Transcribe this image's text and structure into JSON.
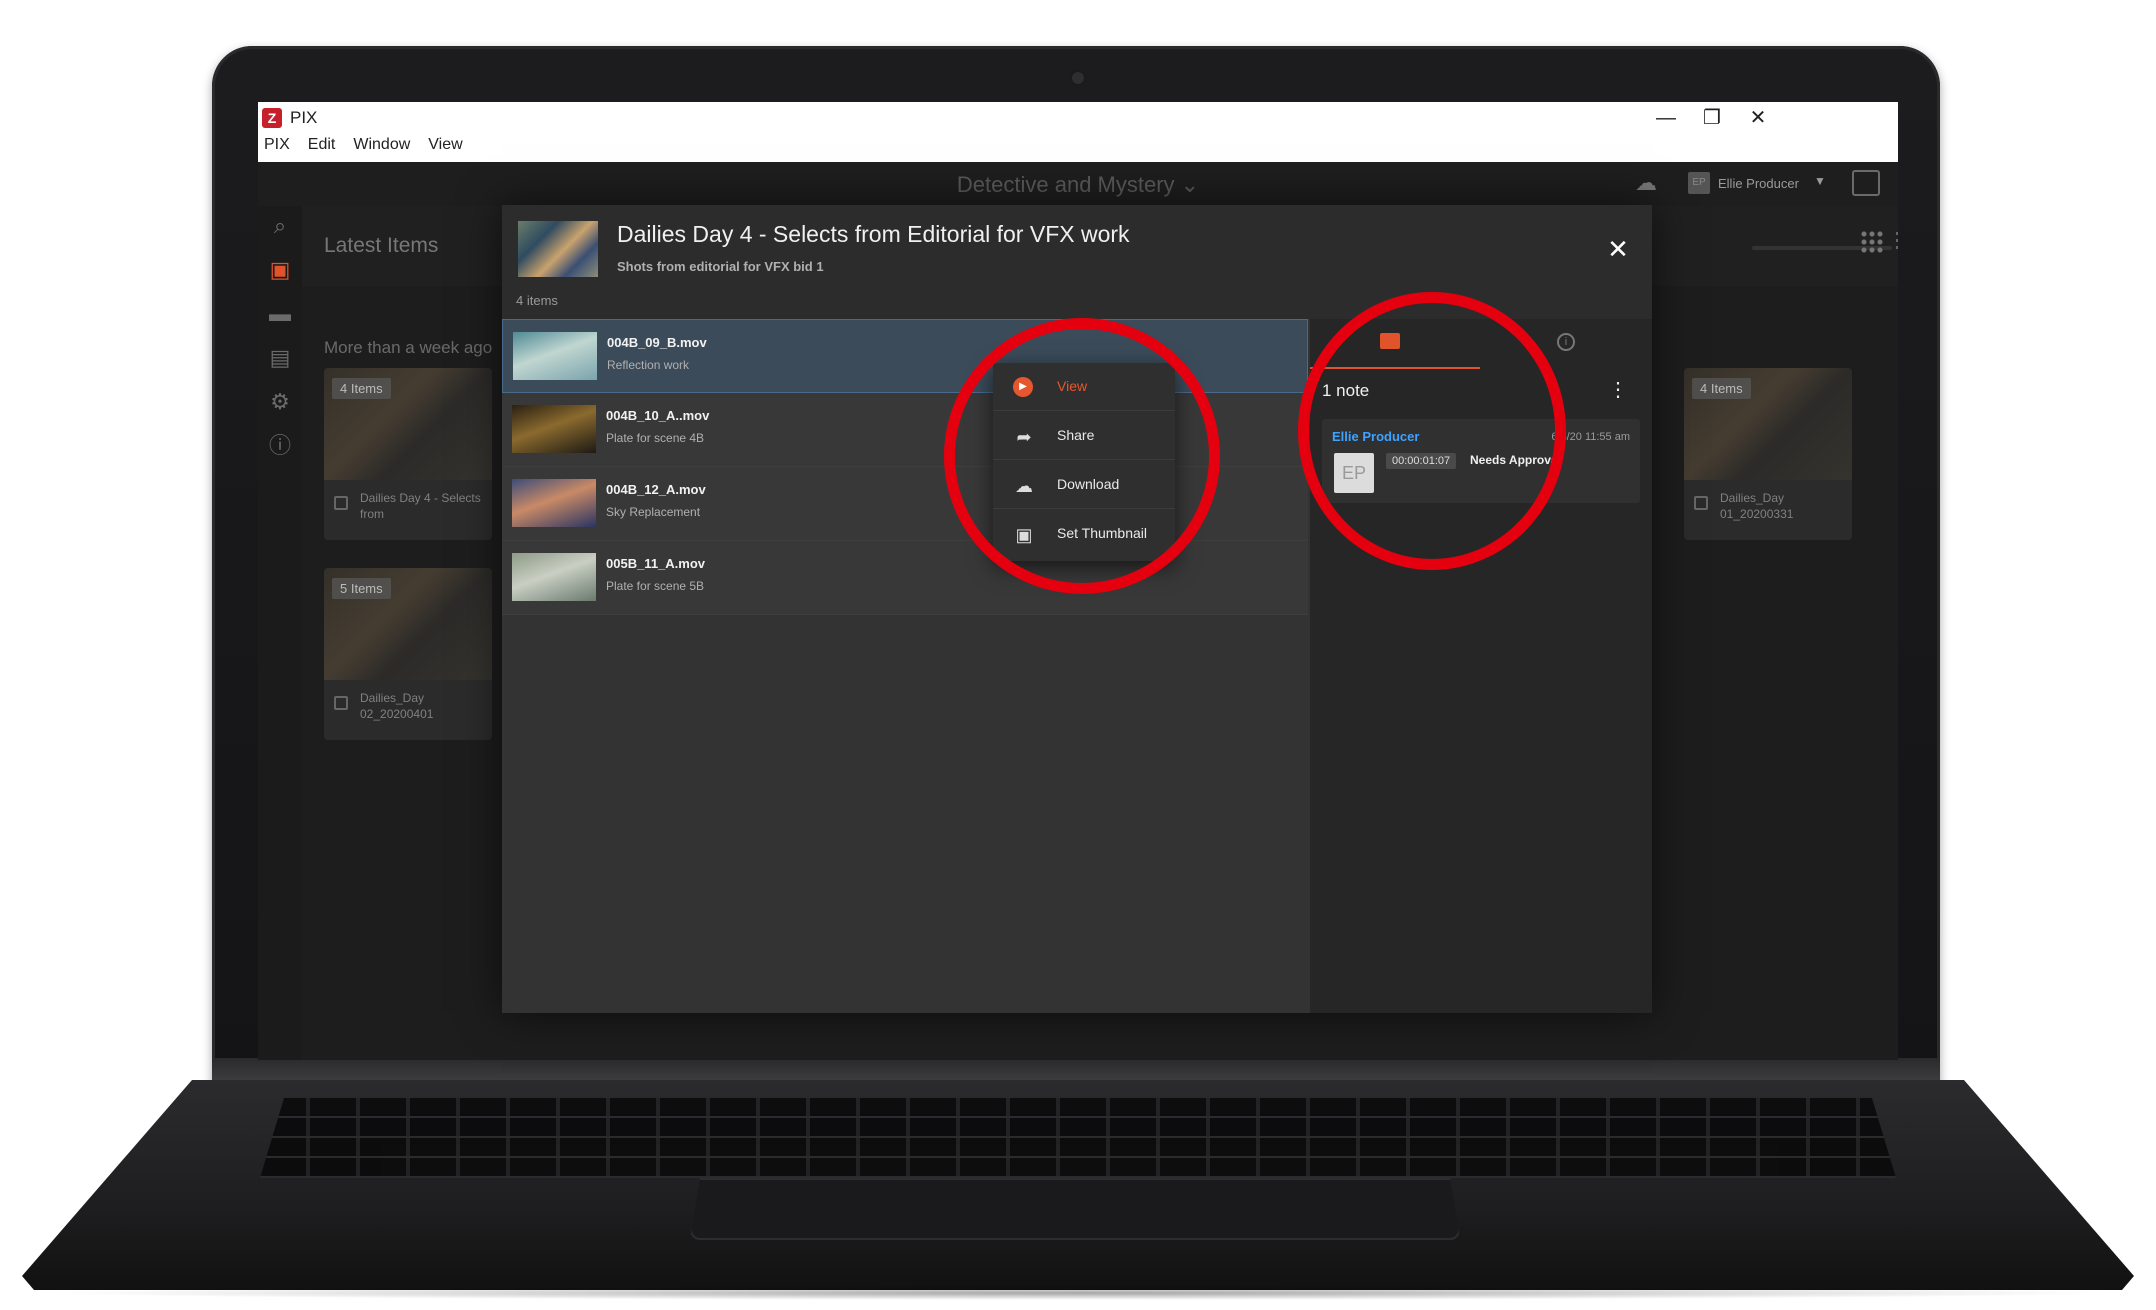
{
  "window": {
    "app_icon_label": "Z",
    "title": "PIX",
    "controls": {
      "minimize": "—",
      "maximize": "❐",
      "close": "✕"
    },
    "menu": [
      "PIX",
      "Edit",
      "Window",
      "View"
    ]
  },
  "topbar": {
    "project": "Detective and Mystery ⌄",
    "user_initials": "EP",
    "user_name": "Ellie Producer",
    "user_caret": "▼"
  },
  "nav": {
    "icons": [
      "search-icon",
      "inbox-icon",
      "folder-icon",
      "media-icon",
      "gear-icon",
      "info-icon"
    ]
  },
  "background": {
    "title": "Latest Items",
    "section": "More than a week ago",
    "cards": [
      {
        "count": "4 Items",
        "name": "Dailies Day 4 - Selects from"
      },
      {
        "count": "5 Items",
        "name": "Dailies_Day 02_20200401"
      },
      {
        "count": "4 Items",
        "name": "Dailies_Day 01_20200331"
      }
    ]
  },
  "modal": {
    "title": "Dailies Day 4 - Selects from Editorial for VFX work",
    "subtitle": "Shots from editorial for VFX bid 1",
    "count": "4 items",
    "close": "✕",
    "items": [
      {
        "name": "004B_09_B.mov",
        "desc": "Reflection work",
        "colors": [
          "#4f8a95",
          "#c0d6d0",
          "#7aa4ad"
        ]
      },
      {
        "name": "004B_10_A..mov",
        "desc": "Plate for scene 4B",
        "colors": [
          "#2a2012",
          "#8b6a2e",
          "#1d1a14"
        ]
      },
      {
        "name": "004B_12_A.mov",
        "desc": "Sky Replacement",
        "colors": [
          "#3c4c7a",
          "#c98a66",
          "#2a3562"
        ]
      },
      {
        "name": "005B_11_A.mov",
        "desc": "Plate for scene 5B",
        "colors": [
          "#8e9a86",
          "#c9cfc3",
          "#6b7a6e"
        ]
      }
    ]
  },
  "context_menu": {
    "items": [
      {
        "label": "View",
        "icon": "play-icon",
        "glyph": "▶"
      },
      {
        "label": "Share",
        "icon": "share-icon",
        "glyph": "➦"
      },
      {
        "label": "Download",
        "icon": "cloud-download-icon",
        "glyph": "☁"
      },
      {
        "label": "Set Thumbnail",
        "icon": "image-icon",
        "glyph": "▣"
      }
    ]
  },
  "notes": {
    "count": "1 note",
    "info_glyph": "i",
    "kebab": "⋮",
    "note": {
      "author": "Ellie Producer",
      "time": "6/3/20 11:55 am",
      "avatar": "EP",
      "timecode": "00:00:01:07",
      "status": "Needs Approval"
    }
  },
  "colors": {
    "accent": "#e0532b",
    "highlight_ring": "#e4000f",
    "link": "#3ea2ff"
  }
}
